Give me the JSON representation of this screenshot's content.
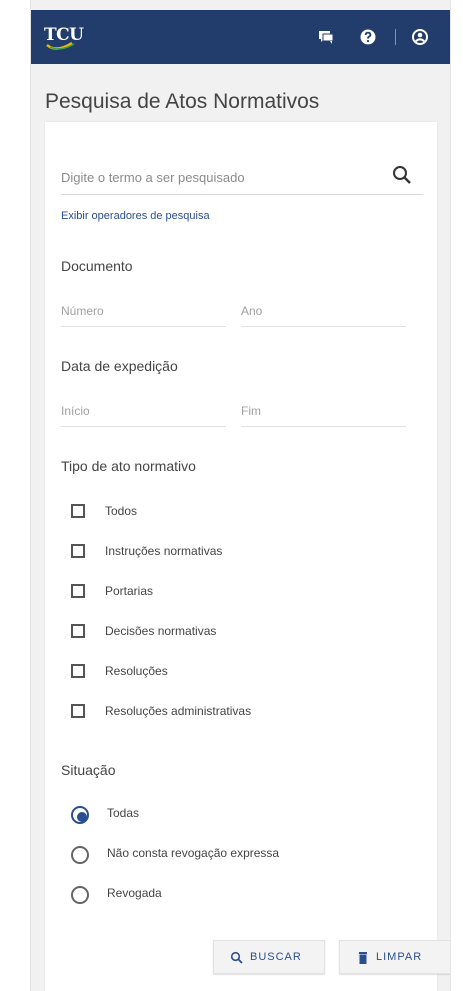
{
  "header": {
    "logo_text": "TCU",
    "icons": [
      "chat-icon",
      "help-icon",
      "user-icon"
    ],
    "bg_color": "#223d6b"
  },
  "page": {
    "title": "Pesquisa de Atos Normativos"
  },
  "search": {
    "placeholder": "Digite o termo a ser pesquisado",
    "value": "",
    "operators_link": "Exibir operadores de pesquisa"
  },
  "documento": {
    "label": "Documento",
    "numero_placeholder": "Número",
    "ano_placeholder": "Ano"
  },
  "data_expedicao": {
    "label": "Data de expedição",
    "inicio_placeholder": "Início",
    "fim_placeholder": "Fim"
  },
  "tipo_ato": {
    "label": "Tipo de ato normativo",
    "options": [
      {
        "label": "Todos",
        "checked": false
      },
      {
        "label": "Instruções normativas",
        "checked": false
      },
      {
        "label": "Portarias",
        "checked": false
      },
      {
        "label": "Decisões normativas",
        "checked": false
      },
      {
        "label": "Resoluções",
        "checked": false
      },
      {
        "label": "Resoluções administrativas",
        "checked": false
      }
    ]
  },
  "situacao": {
    "label": "Situação",
    "options": [
      {
        "label": "Todas",
        "selected": true
      },
      {
        "label": "Não consta revogação expressa",
        "selected": false
      },
      {
        "label": "Revogada",
        "selected": false
      }
    ]
  },
  "actions": {
    "buscar_label": "BUSCAR",
    "limpar_label": "LIMPAR"
  },
  "colors": {
    "accent": "#2a4f8f",
    "header": "#223d6b"
  }
}
